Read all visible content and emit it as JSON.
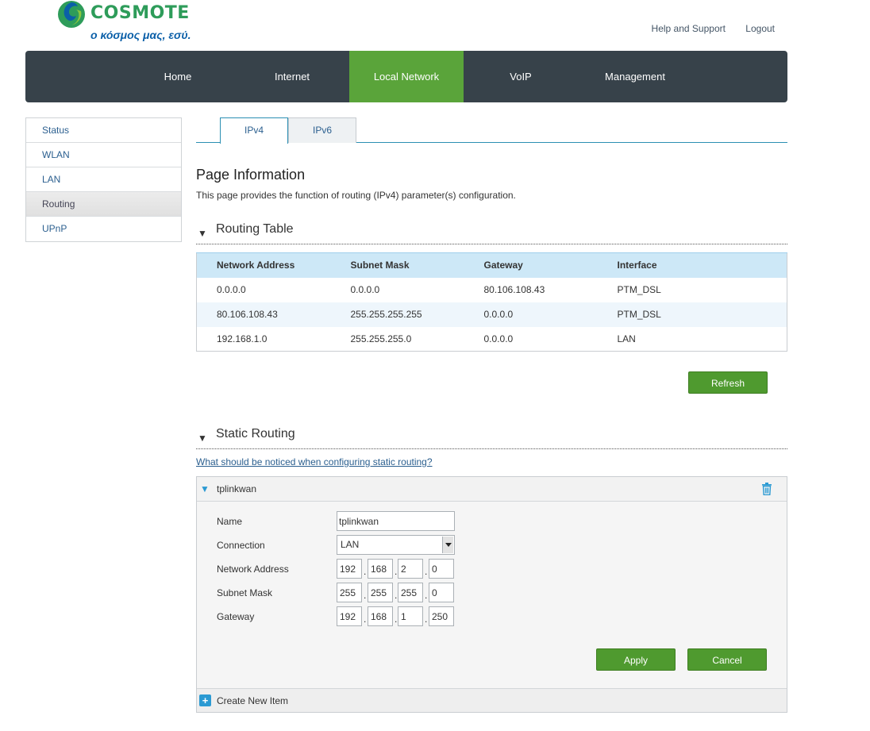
{
  "header": {
    "brand": "COSMOTE",
    "slogan": "ο κόσμος μας, εσύ.",
    "links": [
      "Help and Support",
      "Logout"
    ]
  },
  "nav": {
    "items": [
      "Home",
      "Internet",
      "Local Network",
      "VoIP",
      "Management"
    ],
    "active": "Local Network"
  },
  "sidebar": {
    "items": [
      "Status",
      "WLAN",
      "LAN",
      "Routing",
      "UPnP"
    ],
    "active": "Routing"
  },
  "tabs": {
    "items": [
      "IPv4",
      "IPv6"
    ],
    "active": "IPv4"
  },
  "page": {
    "title": "Page Information",
    "description": "This page provides the function of routing (IPv4) parameter(s) configuration."
  },
  "routing_table": {
    "title": "Routing Table",
    "columns": [
      "Network Address",
      "Subnet Mask",
      "Gateway",
      "Interface"
    ],
    "rows": [
      [
        "0.0.0.0",
        "0.0.0.0",
        "80.106.108.43",
        "PTM_DSL"
      ],
      [
        "80.106.108.43",
        "255.255.255.255",
        "0.0.0.0",
        "PTM_DSL"
      ],
      [
        "192.168.1.0",
        "255.255.255.0",
        "0.0.0.0",
        "LAN"
      ]
    ],
    "refresh_label": "Refresh"
  },
  "static_routing": {
    "title": "Static Routing",
    "help_link": "What should be noticed when configuring static routing?",
    "entry": {
      "name_header": "tplinkwan",
      "labels": {
        "name": "Name",
        "connection": "Connection",
        "network_address": "Network Address",
        "subnet_mask": "Subnet Mask",
        "gateway": "Gateway"
      },
      "name_value": "tplinkwan",
      "connection_value": "LAN",
      "network_address": [
        "192",
        "168",
        "2",
        "0"
      ],
      "subnet_mask": [
        "255",
        "255",
        "255",
        "0"
      ],
      "gateway": [
        "192",
        "168",
        "1",
        "250"
      ]
    },
    "apply_label": "Apply",
    "cancel_label": "Cancel",
    "create_label": "Create New Item"
  },
  "colors": {
    "nav_bg": "#37424a",
    "nav_active": "#5aa43a",
    "button_green": "#4f9a2f",
    "table_header": "#cde8f7",
    "link_blue": "#2b5f8f"
  }
}
